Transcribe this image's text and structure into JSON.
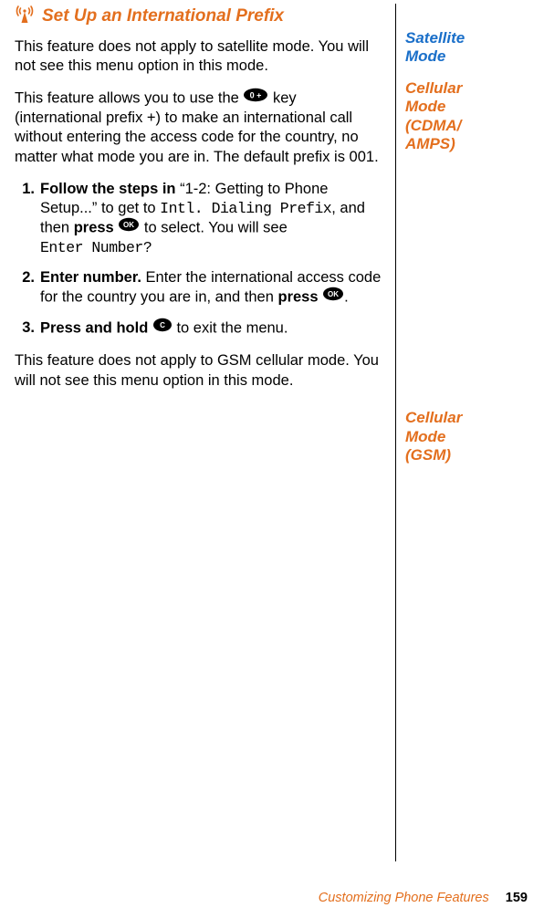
{
  "heading": "Set Up an International Prefix",
  "para_sat": "This feature does not apply to satellite mode. You will not see this menu option in this mode.",
  "para_cdma_a": "This feature allows you to use the ",
  "para_cdma_b": " key (international prefix +) to make an international call without entering the access code for the country, no matter what mode you are in. The default prefix is 001.",
  "steps": {
    "s1_num": "1.",
    "s1_a": "Follow the steps in ",
    "s1_b": "“1-2: Getting to Phone Setup...” to get to ",
    "s1_c": "Intl. Dialing Prefix",
    "s1_d": ", and then ",
    "s1_e": "press ",
    "s1_f": " to select. You will see ",
    "s1_g": "Enter Number?",
    "s2_num": "2.",
    "s2_a": "Enter number.",
    "s2_b": " Enter the international access code for the country you are in, and then ",
    "s2_c": "press ",
    "s2_d": ".",
    "s3_num": "3.",
    "s3_a": "Press and hold ",
    "s3_b": " to exit the menu."
  },
  "para_gsm": "This feature does not apply to GSM cellular mode. You will not see this menu option in this mode.",
  "side": {
    "sat1": "Satellite",
    "sat2": "Mode",
    "cdma1": "Cellular",
    "cdma2": "Mode",
    "cdma3": "(CDMA/",
    "cdma4": "AMPS)",
    "gsm1": "Cellular",
    "gsm2": "Mode",
    "gsm3": "(GSM)"
  },
  "footer_label": "Customizing Phone Features",
  "footer_page": "159"
}
